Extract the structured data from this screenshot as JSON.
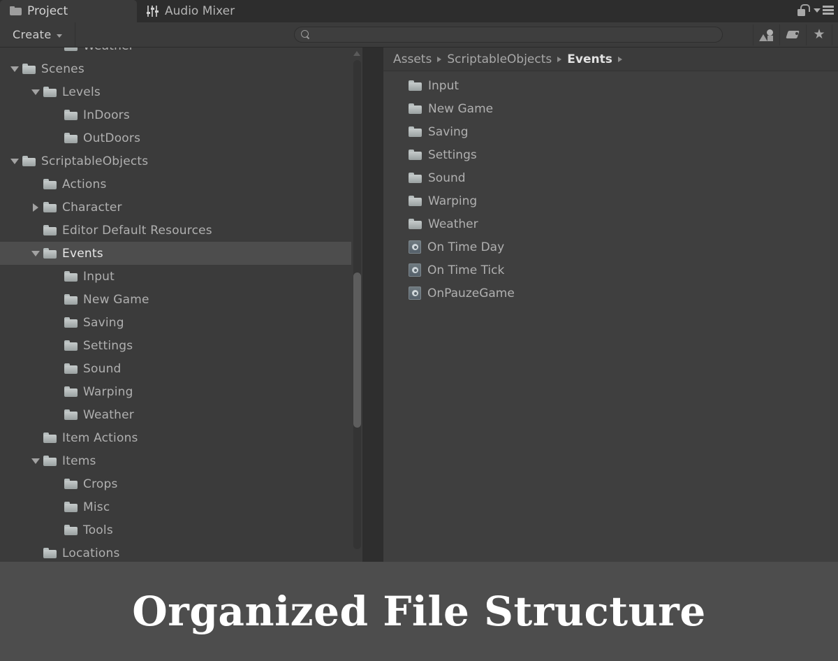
{
  "window": {
    "tabs": [
      {
        "label": "Project",
        "icon": "folder-icon",
        "active": true
      },
      {
        "label": "Audio Mixer",
        "icon": "audio-mixer-icon",
        "active": false
      }
    ],
    "lock_icon": "lock-open-icon",
    "menu_icon": "hamburger-menu-icon"
  },
  "toolbar": {
    "create_label": "Create",
    "create_caret": "chevron-down-icon",
    "search": {
      "value": "",
      "placeholder": "",
      "icon": "search-icon"
    },
    "filters": [
      {
        "name": "filter-by-type-button",
        "icon": "shapes-icon"
      },
      {
        "name": "filter-by-label-button",
        "icon": "tag-icon"
      },
      {
        "name": "favorites-button",
        "icon": "star-icon"
      }
    ]
  },
  "tree": {
    "rows": [
      {
        "label": "Weather",
        "indent": 3,
        "twisty": "none",
        "selected": false,
        "cut": true
      },
      {
        "label": "Scenes",
        "indent": 1,
        "twisty": "expanded",
        "selected": false
      },
      {
        "label": "Levels",
        "indent": 2,
        "twisty": "expanded",
        "selected": false
      },
      {
        "label": "InDoors",
        "indent": 3,
        "twisty": "none",
        "selected": false
      },
      {
        "label": "OutDoors",
        "indent": 3,
        "twisty": "none",
        "selected": false
      },
      {
        "label": "ScriptableObjects",
        "indent": 1,
        "twisty": "expanded",
        "selected": false
      },
      {
        "label": "Actions",
        "indent": 2,
        "twisty": "none",
        "selected": false
      },
      {
        "label": "Character",
        "indent": 2,
        "twisty": "collapsed",
        "selected": false
      },
      {
        "label": "Editor Default Resources",
        "indent": 2,
        "twisty": "none",
        "selected": false
      },
      {
        "label": "Events",
        "indent": 2,
        "twisty": "expanded",
        "selected": true
      },
      {
        "label": "Input",
        "indent": 3,
        "twisty": "none",
        "selected": false
      },
      {
        "label": "New Game",
        "indent": 3,
        "twisty": "none",
        "selected": false
      },
      {
        "label": "Saving",
        "indent": 3,
        "twisty": "none",
        "selected": false
      },
      {
        "label": "Settings",
        "indent": 3,
        "twisty": "none",
        "selected": false
      },
      {
        "label": "Sound",
        "indent": 3,
        "twisty": "none",
        "selected": false
      },
      {
        "label": "Warping",
        "indent": 3,
        "twisty": "none",
        "selected": false
      },
      {
        "label": "Weather",
        "indent": 3,
        "twisty": "none",
        "selected": false
      },
      {
        "label": "Item Actions",
        "indent": 2,
        "twisty": "none",
        "selected": false
      },
      {
        "label": "Items",
        "indent": 2,
        "twisty": "expanded",
        "selected": false
      },
      {
        "label": "Crops",
        "indent": 3,
        "twisty": "none",
        "selected": false
      },
      {
        "label": "Misc",
        "indent": 3,
        "twisty": "none",
        "selected": false
      },
      {
        "label": "Tools",
        "indent": 3,
        "twisty": "none",
        "selected": false
      },
      {
        "label": "Locations",
        "indent": 2,
        "twisty": "none",
        "selected": false
      }
    ]
  },
  "content": {
    "breadcrumb": [
      {
        "label": "Assets",
        "current": false
      },
      {
        "label": "ScriptableObjects",
        "current": false
      },
      {
        "label": "Events",
        "current": true
      }
    ],
    "assets": [
      {
        "label": "Input",
        "type": "folder"
      },
      {
        "label": "New Game",
        "type": "folder"
      },
      {
        "label": "Saving",
        "type": "folder"
      },
      {
        "label": "Settings",
        "type": "folder"
      },
      {
        "label": "Sound",
        "type": "folder"
      },
      {
        "label": "Warping",
        "type": "folder"
      },
      {
        "label": "Weather",
        "type": "folder"
      },
      {
        "label": "On Time Day",
        "type": "scriptable-object"
      },
      {
        "label": "On Time Tick",
        "type": "scriptable-object"
      },
      {
        "label": "OnPauzeGame",
        "type": "scriptable-object"
      }
    ]
  },
  "caption": {
    "text": "Organized File Structure"
  },
  "colors": {
    "window_bg": "#3b3b3b",
    "tabbar_bg": "#2d2d2d",
    "content_bg": "#3f3f3f",
    "selection_bg": "#4d4d4d",
    "text": "#b0b0b0",
    "text_bright": "#e8e8e8",
    "caption_bg": "#4d4d4d",
    "caption_text": "#ffffff",
    "folder_icon": "#b5bcbc"
  }
}
